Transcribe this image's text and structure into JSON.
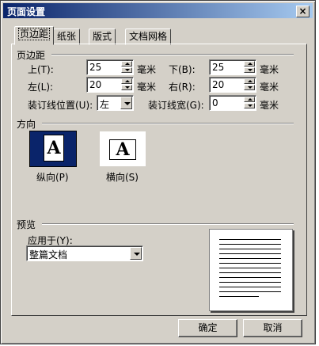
{
  "window": {
    "title": "页面设置",
    "close_glyph": "×"
  },
  "tabs": [
    {
      "label": "页边距",
      "active": true
    },
    {
      "label": "纸张",
      "active": false
    },
    {
      "label": "版式",
      "active": false
    },
    {
      "label": "文档网格",
      "active": false
    }
  ],
  "margins": {
    "group_label": "页边距",
    "top": {
      "label": "上(T):",
      "value": "25",
      "unit": "毫米"
    },
    "bottom": {
      "label": "下(B):",
      "value": "25",
      "unit": "毫米"
    },
    "left": {
      "label": "左(L):",
      "value": "20",
      "unit": "毫米"
    },
    "right": {
      "label": "右(R):",
      "value": "20",
      "unit": "毫米"
    },
    "gutter_position": {
      "label": "装订线位置(U):",
      "value": "左"
    },
    "gutter": {
      "label": "装订线宽(G):",
      "value": "0",
      "unit": "毫米"
    }
  },
  "orientation": {
    "group_label": "方向",
    "portrait": {
      "label": "纵向(P)",
      "glyph": "A",
      "selected": true
    },
    "landscape": {
      "label": "横向(S)",
      "glyph": "A",
      "selected": false
    }
  },
  "preview": {
    "group_label": "预览",
    "apply_to": {
      "label": "应用于(Y):",
      "value": "整篇文档"
    }
  },
  "buttons": {
    "ok": "确定",
    "cancel": "取消"
  }
}
